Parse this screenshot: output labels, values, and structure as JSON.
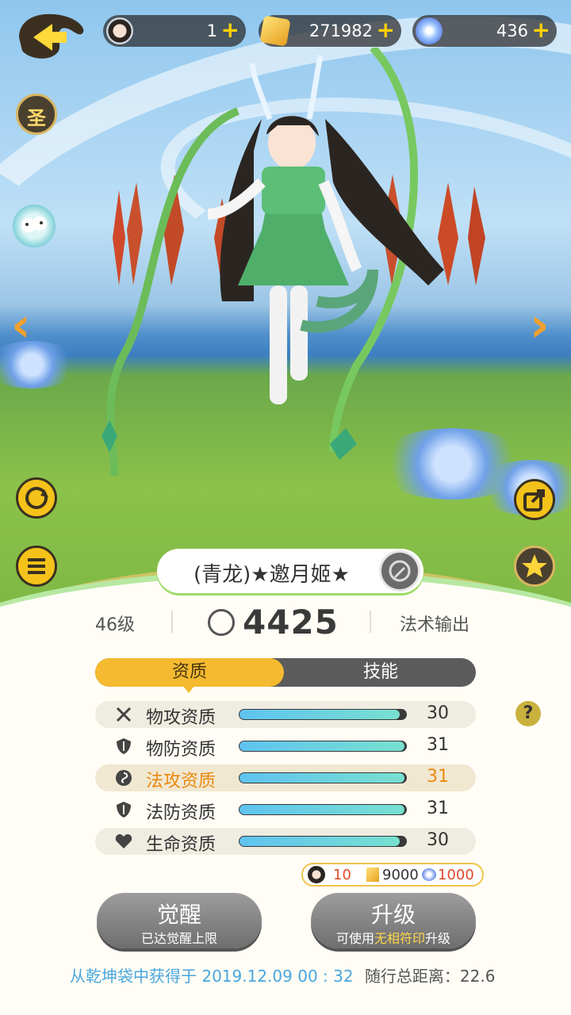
{
  "topbar": {
    "resources": [
      {
        "icon": "avatar-token-icon",
        "value": "1"
      },
      {
        "icon": "gold-coin-icon",
        "value": "271982"
      },
      {
        "icon": "diamond-icon",
        "value": "436"
      }
    ],
    "plus": "+"
  },
  "side": {
    "holy_label": "圣"
  },
  "character": {
    "name": "(青龙)★邀月姬★",
    "level": "46级",
    "power": "4425",
    "role": "法术输出"
  },
  "tabs": {
    "active": "资质",
    "other": "技能"
  },
  "stats": [
    {
      "icon": "sword-icon",
      "label": "物攻资质",
      "value": "30",
      "fill": 0.96,
      "highlight": false
    },
    {
      "icon": "shield-icon",
      "label": "物防资质",
      "value": "31",
      "fill": 0.99,
      "highlight": false
    },
    {
      "icon": "spiral-icon",
      "label": "法攻资质",
      "value": "31",
      "fill": 0.99,
      "highlight": true
    },
    {
      "icon": "shield-icon",
      "label": "法防资质",
      "value": "31",
      "fill": 0.99,
      "highlight": false
    },
    {
      "icon": "heart-icon",
      "label": "生命资质",
      "value": "30",
      "fill": 0.96,
      "highlight": false
    }
  ],
  "cost": {
    "token": "10",
    "gold": "9000",
    "diamond": "1000"
  },
  "buttons": {
    "awaken": {
      "title": "觉醒",
      "sub": "已达觉醒上限"
    },
    "upgrade": {
      "title": "升级",
      "sub_pre": "可使用",
      "sub_hl": "无相符印",
      "sub_post": "升级"
    }
  },
  "footer": {
    "pre": "从乾坤袋中获得于 2019.12.09 00 : 32",
    "post": "随行总距离：22.6"
  },
  "colors": {
    "accent": "#f5ba30",
    "highlight_text": "#e98a10",
    "bar": "#5fc3f0",
    "footer": "#49a6de"
  }
}
